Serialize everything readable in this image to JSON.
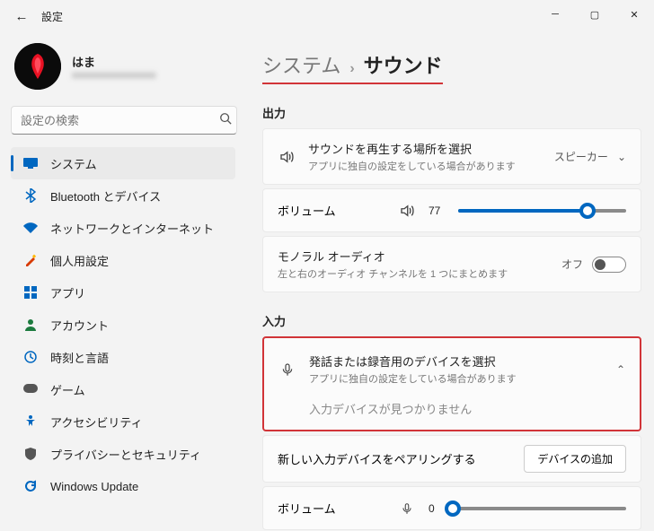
{
  "titlebar": {
    "caption": "設定"
  },
  "profile": {
    "name": "はま",
    "email": "xxxxxxxxxxxxxxxxx"
  },
  "search": {
    "placeholder": "設定の検索"
  },
  "nav": [
    {
      "label": "システム",
      "icon": "system",
      "selected": true
    },
    {
      "label": "Bluetooth とデバイス",
      "icon": "bluetooth"
    },
    {
      "label": "ネットワークとインターネット",
      "icon": "wifi"
    },
    {
      "label": "個人用設定",
      "icon": "personalize"
    },
    {
      "label": "アプリ",
      "icon": "apps"
    },
    {
      "label": "アカウント",
      "icon": "account"
    },
    {
      "label": "時刻と言語",
      "icon": "time"
    },
    {
      "label": "ゲーム",
      "icon": "game"
    },
    {
      "label": "アクセシビリティ",
      "icon": "accessibility"
    },
    {
      "label": "プライバシーとセキュリティ",
      "icon": "privacy"
    },
    {
      "label": "Windows Update",
      "icon": "update"
    }
  ],
  "breadcrumb": {
    "parent": "システム",
    "current": "サウンド",
    "sep": "›"
  },
  "output": {
    "heading": "出力",
    "select": {
      "title": "サウンドを再生する場所を選択",
      "sub": "アプリに独自の設定をしている場合があります",
      "value": "スピーカー"
    },
    "volume": {
      "label": "ボリューム",
      "value": 77
    },
    "mono": {
      "title": "モノラル オーディオ",
      "sub": "左と右のオーディオ チャンネルを 1 つにまとめます",
      "state": "オフ"
    }
  },
  "input": {
    "heading": "入力",
    "select": {
      "title": "発話または録音用のデバイスを選択",
      "sub": "アプリに独自の設定をしている場合があります"
    },
    "notfound": "入力デバイスが見つかりません",
    "pair": {
      "text": "新しい入力デバイスをペアリングする",
      "button": "デバイスの追加"
    },
    "volume": {
      "label": "ボリューム",
      "value": 0
    }
  }
}
